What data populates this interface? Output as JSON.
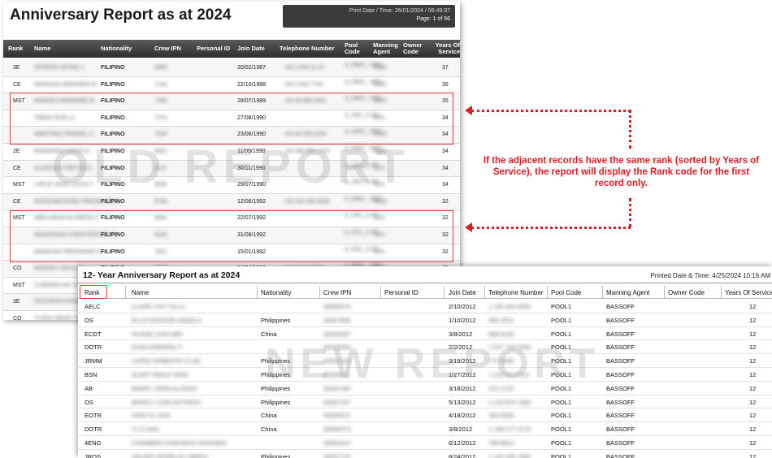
{
  "old_report": {
    "title": "Anniversary Report as at 2024",
    "print_line1": "Print Date / Time: 26/01/2024 / 06:49:37",
    "print_line2": "Page: 1 of 56",
    "watermark": "OLD REPORT",
    "headers": {
      "rank": "Rank",
      "name": "Name",
      "nationality": "Nationality",
      "crew_ipn": "Crew IPN",
      "personal_id": "Personal ID",
      "join_date": "Join Date",
      "telephone": "Telephone Number",
      "pool_code": "Pool Code",
      "manning_agent": "Manning Agent",
      "owner_code": "Owner Code",
      "years": "Years Of Service"
    },
    "rows": [
      {
        "rank": "3E",
        "name": "OPINION JESSIE J.",
        "nat": "FILIPINO",
        "ipn": "0480",
        "join": "20/02/1987",
        "tel": "+63 2 000 21 67",
        "pool": "A_MMC_ OFF",
        "agent": "MMC",
        "yrs": "37"
      },
      {
        "rank": "CE",
        "name": "NARANJA ARMANDO B.",
        "nat": "FILIPINO",
        "ipn": "7144",
        "join": "22/10/1988",
        "tel": "+63 2 832 7781",
        "pool": "A_MMC_ OFF",
        "agent": "MMC",
        "yrs": "36"
      },
      {
        "rank": "MST",
        "name": "MANDEO BERNABE M.",
        "nat": "FILIPINO",
        "ipn": "7490",
        "join": "28/07/1989",
        "tel": "+63 45 888 3021",
        "pool": "A_MMC_ OFF",
        "agent": "MMC",
        "yrs": "35"
      },
      {
        "rank": "",
        "name": "TABAS RUEL A.",
        "nat": "FILIPINO",
        "ipn": "7474",
        "join": "27/06/1990",
        "tel": "",
        "pool": "A_SOL_0 SF",
        "agent": "SFA",
        "yrs": "34"
      },
      {
        "rank": "",
        "name": "MARTINEZ RHONEL C.",
        "nat": "FILIPINO",
        "ipn": "7535",
        "join": "23/06/1990",
        "tel": "+63 45 305 8152",
        "pool": "A_MMC_ OFF",
        "agent": "MMC",
        "yrs": "34"
      },
      {
        "rank": "2E",
        "name": "MARIANAN DANDI D.",
        "nat": "FILIPINO",
        "ipn": "8603",
        "join": "11/09/1990",
        "tel": "+63 948 999 1224",
        "pool": "A_MMC_ OFF",
        "agent": "MMC",
        "yrs": "34"
      },
      {
        "rank": "CE",
        "name": "ALARCON FRETZO D.",
        "nat": "FILIPINO",
        "ipn": "8137",
        "join": "30/11/1990",
        "tel": "",
        "pool": "A_SOL_0 SF",
        "agent": "SFA",
        "yrs": "34"
      },
      {
        "rank": "MST",
        "name": "LAPUZ JOHN LOUIS T.",
        "nat": "FILIPINO",
        "ipn": "6493",
        "join": "29/07/1990",
        "tel": "",
        "pool": "A_SOL_0 SF",
        "agent": "SFA",
        "yrs": "34"
      },
      {
        "rank": "CE",
        "name": "MANGABUNONG FREDELITO R.",
        "nat": "FILIPINO",
        "ipn": "8794",
        "join": "12/06/1992",
        "tel": "+63 915 454 9648",
        "pool": "A_MMC_ OFF",
        "agent": "MMC",
        "yrs": "32"
      },
      {
        "rank": "MST",
        "name": "ABELARDO ALFREDO C.",
        "nat": "FILIPINO",
        "ipn": "8064",
        "join": "22/07/1992",
        "tel": "",
        "pool": "A_SOL_0 SF",
        "agent": "SFA",
        "yrs": "32"
      },
      {
        "rank": "",
        "name": "BAGAGNAN CHRISTOPHER S.",
        "nat": "FILIPINO",
        "ipn": "8186",
        "join": "31/08/1992",
        "tel": "",
        "pool": "A_SOL_0 SF",
        "agent": "SFA",
        "yrs": "32"
      },
      {
        "rank": "",
        "name": "BANAHAN FERDINAND R.",
        "nat": "FILIPINO",
        "ipn": "7801",
        "join": "15/01/1992",
        "tel": "",
        "pool": "A_SOL_0 SF",
        "agent": "SFA",
        "yrs": "32"
      },
      {
        "rank": "CO",
        "name": "BORRES JERIC G.",
        "nat": "FILIPINO",
        "ipn": "8823",
        "join": "24/04/1992",
        "tel": "+63 2 315 9063",
        "pool": "A_MMC_ OFF",
        "agent": "MMC",
        "yrs": "32"
      },
      {
        "rank": "MST",
        "name": "CUMANDLAR LOUIE",
        "nat": "",
        "ipn": "",
        "join": "",
        "tel": "",
        "pool": "",
        "agent": "",
        "yrs": ""
      },
      {
        "rank": "3E",
        "name": "PESUERIA DONAL",
        "nat": "",
        "ipn": "",
        "join": "",
        "tel": "",
        "pool": "",
        "agent": "",
        "yrs": ""
      },
      {
        "rank": "CO",
        "name": "TUPAS HENRY DE",
        "nat": "",
        "ipn": "",
        "join": "",
        "tel": "",
        "pool": "",
        "agent": "",
        "yrs": ""
      }
    ]
  },
  "annotation": {
    "text": "If the adjacent records have the same rank (sorted by Years of Service), the report will display the Rank code for the first record only."
  },
  "new_report": {
    "title": "12- Year Anniversary Report as at 2024",
    "print": "Printed Date & Time: 4/25/2024 10:16 AM",
    "watermark": "NEW REPORT",
    "headers": {
      "rank": "Rank",
      "name": "Name",
      "nationality": "Nationality",
      "crew_ipn": "Crew IPN",
      "personal_id": "Personal ID",
      "join_date": "Join Date",
      "telephone": "Telephone Number",
      "pool_code": "Pool Code",
      "manning_agent": "Manning Agent",
      "owner_code": "Owner Code",
      "years": "Years Of Service"
    },
    "rows": [
      {
        "rank": "AELC",
        "name": "CLARK COY VILLA",
        "nat": "",
        "ipn": "00000075",
        "join": "2/10/2012",
        "tel": "1 180 483 0034",
        "pool": "POOL1",
        "agent": "BASSOFF",
        "yrs": "12"
      },
      {
        "rank": "OS",
        "name": "ELLIS ERSKON ANGELA",
        "nat": "Philippines",
        "ipn": "00007899",
        "join": "1/10/2012",
        "tel": "384-2021",
        "pool": "POOL1",
        "agent": "BASSOFF",
        "yrs": "12"
      },
      {
        "rank": "ECDT",
        "name": "HUANG XIAO MEI",
        "nat": "China",
        "ipn": "00040387",
        "join": "3/8/2012",
        "tel": "888-4143",
        "pool": "POOL1",
        "agent": "BASSOFF",
        "yrs": "12"
      },
      {
        "rank": "DOTR",
        "name": "EVAN EDMOND T.",
        "nat": "",
        "ipn": "00000056",
        "join": "2/2/2012",
        "tel": "1 237 724 0045",
        "pool": "POOL1",
        "agent": "BASSOFF",
        "yrs": "12"
      },
      {
        "rank": "JRMM",
        "name": "LOPEZ ROBERTO CLAE",
        "nat": "Philippines",
        "ipn": "00002143",
        "join": "3/19/2012",
        "tel": "777-0000",
        "pool": "POOL1",
        "agent": "BASSOFF",
        "yrs": "12"
      },
      {
        "rank": "BSN",
        "name": "ALERT EMILE ORIN",
        "nat": "Philippines",
        "ipn": "00004211",
        "join": "1/27/2012",
        "tel": "1 216 16 2 013",
        "pool": "POOL1",
        "agent": "BASSOFF",
        "yrs": "12"
      },
      {
        "rank": "AB",
        "name": "BARRY JOHN ALONZO",
        "nat": "Philippines",
        "ipn": "00001344",
        "join": "3/18/2012",
        "tel": "222-1120",
        "pool": "POOL1",
        "agent": "BASSOFF",
        "yrs": "12"
      },
      {
        "rank": "OS",
        "name": "BRADLY CON ANTHONY",
        "nat": "Philippines",
        "ipn": "00007707",
        "join": "5/13/2012",
        "tel": "1 216 876 1560",
        "pool": "POOL1",
        "agent": "BASSOFF",
        "yrs": "12"
      },
      {
        "rank": "EOTR",
        "name": "KOW FU SAN",
        "nat": "China",
        "ipn": "00044072",
        "join": "4/18/2012",
        "tel": "284-8205",
        "pool": "POOL1",
        "agent": "BASSOFF",
        "yrs": "12"
      },
      {
        "rank": "DOTR",
        "name": "YI ZI SAN",
        "nat": "China",
        "ipn": "00000074",
        "join": "3/8/2012",
        "tel": "1 198 277-2174",
        "pool": "POOL1",
        "agent": "BASSOFF",
        "yrs": "12"
      },
      {
        "rank": "4ENG",
        "name": "CHAMBER CHADWICK ROSARIO",
        "nat": "",
        "ipn": "00002414",
        "join": "6/12/2012",
        "tel": "788-8612",
        "pool": "POOL1",
        "agent": "BASSOFF",
        "yrs": "12"
      },
      {
        "rank": "JROS",
        "name": "VALDEZ ROGELIO LIBRES",
        "nat": "Philippines",
        "ipn": "00007720",
        "join": "8/24/2012",
        "tel": "1 150 266 1680",
        "pool": "POOL1",
        "agent": "BASSOFF",
        "yrs": "12"
      }
    ]
  },
  "colors": {
    "highlight": "#e23b3b",
    "annotation": "#d71e28",
    "header_dark": "#3b3b3b"
  }
}
